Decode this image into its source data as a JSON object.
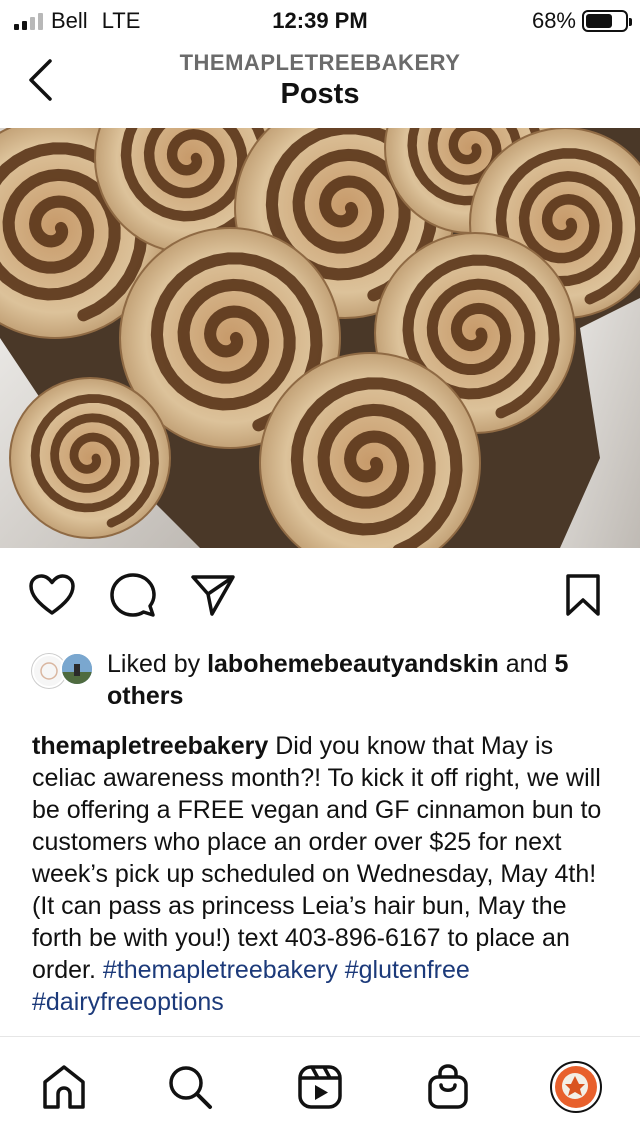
{
  "status_bar": {
    "carrier": "Bell",
    "network": "LTE",
    "time": "12:39 PM",
    "battery_percent_label": "68%",
    "battery_level": 0.68,
    "signal_bars": 2
  },
  "header": {
    "account_name": "THEMAPLETREEBAKERY",
    "title": "Posts",
    "back_icon": "chevron-left-icon"
  },
  "post": {
    "image_subject": "cinnamon buns",
    "actions": {
      "like_icon": "heart-icon",
      "comment_icon": "comment-icon",
      "share_icon": "send-icon",
      "save_icon": "bookmark-icon"
    },
    "likes": {
      "prefix": "Liked by",
      "user": "labohemebeautyandskin",
      "joiner": "and",
      "others": "5 others"
    },
    "caption": {
      "username": "themapletreebakery",
      "text": "Did you know that May is celiac awareness month?! To kick it off right, we will be offering a FREE vegan and GF cinnamon bun to customers who place an order over $25 for next week’s pick up scheduled on Wednesday, May 4th! (It can pass as princess Leia’s hair bun, May the forth be with you!) text 403-896-6167 to place an order.",
      "hashtags": [
        "#themapletreebakery",
        "#glutenfree",
        "#dairyfreeoptions"
      ]
    }
  },
  "tab_bar": {
    "items": [
      "home-icon",
      "search-icon",
      "reels-icon",
      "shop-icon",
      "profile-avatar"
    ]
  },
  "colors": {
    "text": "#111111",
    "secondary_text": "#6b6b6b",
    "hashtag": "#1c3a7a",
    "profile_ring": "#e8602c"
  }
}
